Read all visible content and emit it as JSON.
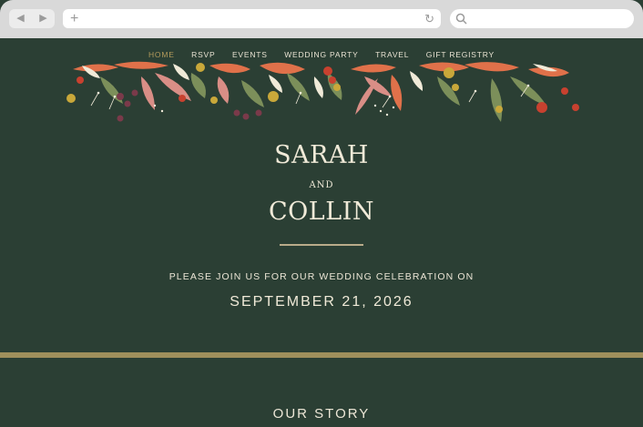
{
  "browser": {
    "back_icon": "back-arrow-icon",
    "forward_icon": "forward-arrow-icon",
    "new_tab_icon": "plus-icon",
    "reload_icon": "reload-icon",
    "search_icon": "search-icon"
  },
  "nav": {
    "items": [
      {
        "label": "HOME",
        "active": true
      },
      {
        "label": "RSVP",
        "active": false
      },
      {
        "label": "EVENTS",
        "active": false
      },
      {
        "label": "WEDDING PARTY",
        "active": false
      },
      {
        "label": "TRAVEL",
        "active": false
      },
      {
        "label": "GIFT REGISTRY",
        "active": false
      }
    ]
  },
  "hero": {
    "name1": "SARAH",
    "conjunction": "AND",
    "name2": "COLLIN",
    "invite_text": "PLEASE JOIN US FOR OUR WEDDING CELEBRATION ON",
    "date": "SEPTEMBER 21, 2026"
  },
  "sections": {
    "story_title": "OUR STORY"
  },
  "colors": {
    "background": "#2b3f34",
    "accent_gold": "#a0905c",
    "text_cream": "#f0ead8",
    "floral_coral": "#e0714a",
    "floral_pink": "#d98e86",
    "floral_sage": "#7c8f5a",
    "floral_mustard": "#c9a83a",
    "floral_red": "#c8412f",
    "floral_plum": "#7a3a4a"
  }
}
